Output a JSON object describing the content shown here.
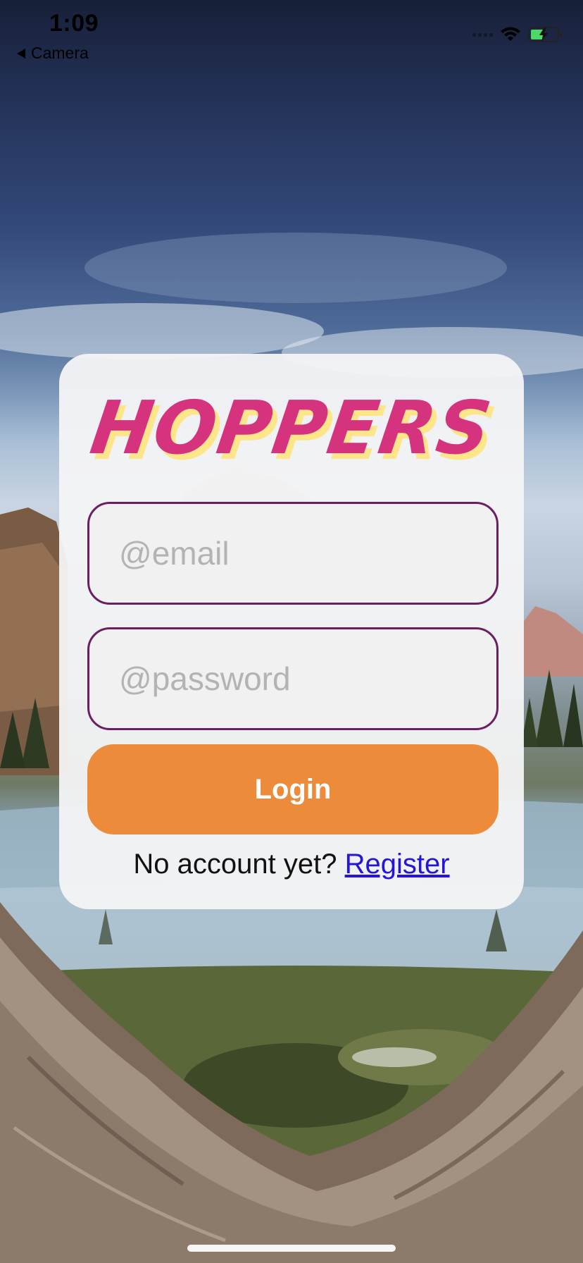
{
  "status_bar": {
    "time": "1:09",
    "back_app": "Camera"
  },
  "brand": {
    "logo_text": "HOPPERS",
    "logo_color": "#d6337f",
    "logo_shadow_color": "#fde68a"
  },
  "login_form": {
    "email_placeholder": "@email",
    "password_placeholder": "@password",
    "login_label": "Login",
    "no_account_text": "No account yet?",
    "register_label": "Register"
  },
  "colors": {
    "accent_orange": "#ec8b3a",
    "input_border": "#6b1f63",
    "link_blue": "#2515d8"
  },
  "icons": [
    "back-arrow-icon",
    "signal-icon",
    "wifi-icon",
    "battery-charging-icon"
  ]
}
